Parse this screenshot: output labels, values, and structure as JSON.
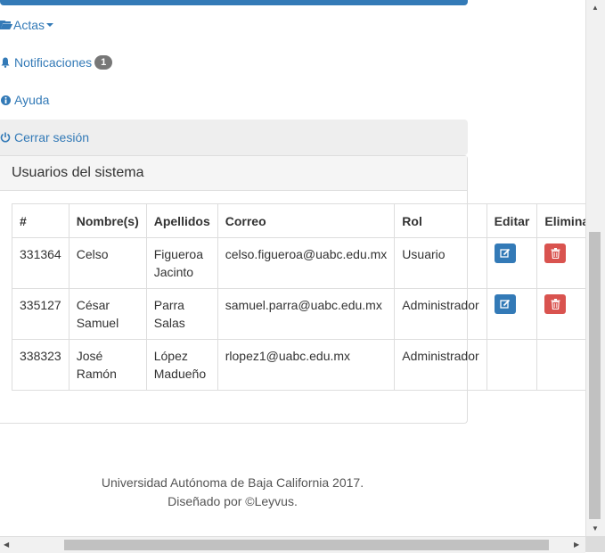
{
  "nav": {
    "actas": "Actas",
    "notificaciones": "Notificaciones",
    "notificaciones_count": "1",
    "ayuda": "Ayuda",
    "cerrar_sesion": "Cerrar sesión"
  },
  "panel": {
    "title": "Usuarios del sistema",
    "columns": [
      "#",
      "Nombre(s)",
      "Apellidos",
      "Correo",
      "Rol",
      "Editar",
      "Eliminar"
    ],
    "rows": [
      {
        "id": "331364",
        "nombre_1": "Celso",
        "nombre_2": "",
        "apellido_1": "Figueroa",
        "apellido_2": "Jacinto",
        "correo": "celso.figueroa@uabc.edu.mx",
        "rol": "Usuario"
      },
      {
        "id": "335127",
        "nombre_1": "César",
        "nombre_2": "Samuel",
        "apellido_1": "Parra",
        "apellido_2": "Salas",
        "correo": "samuel.parra@uabc.edu.mx",
        "rol": "Administrador"
      },
      {
        "id": "338323",
        "nombre_1": "José",
        "nombre_2": "Ramón",
        "apellido_1": "López",
        "apellido_2": "Madueño",
        "correo": "rlopez1@uabc.edu.mx",
        "rol": "Administrador"
      }
    ]
  },
  "footer": {
    "line1": "Universidad Autónoma de Baja California 2017.",
    "line2": "Diseñado por ©Leyvus."
  },
  "colors": {
    "primary": "#337ab7",
    "danger": "#d9534f",
    "badge": "#777777"
  },
  "icons": {
    "actas": "folder-open-icon",
    "notificaciones": "bell-icon",
    "ayuda": "info-circle-icon",
    "cerrar_sesion": "power-off-icon",
    "editar": "edit-icon",
    "eliminar": "trash-icon"
  }
}
